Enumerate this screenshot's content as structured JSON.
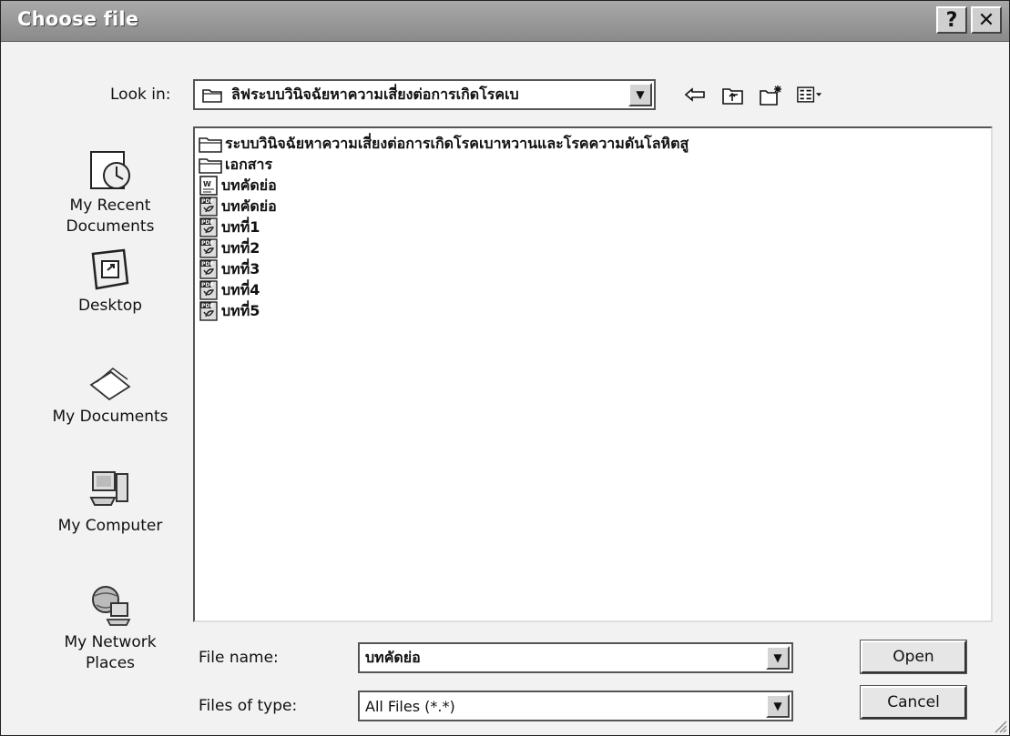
{
  "window": {
    "title": "Choose file"
  },
  "titlebar_buttons": {
    "help_label": "?",
    "close_label": "✕"
  },
  "look_in": {
    "label": "Look in:",
    "value": "ลิฟระบบวินิจฉัยหาความเสี่ยงต่อการเกิดโรคเบ"
  },
  "toolbar": {
    "icons": [
      "back-icon",
      "up-folder-icon",
      "new-folder-icon",
      "views-menu-icon"
    ]
  },
  "places": [
    {
      "name": "my-recent-documents",
      "line1": "My Recent",
      "line2": "Documents",
      "icon": "recent-documents-icon"
    },
    {
      "name": "desktop",
      "line1": "Desktop",
      "line2": "",
      "icon": "desktop-icon"
    },
    {
      "name": "my-documents",
      "line1": "My Documents",
      "line2": "",
      "icon": "my-documents-icon"
    },
    {
      "name": "my-computer",
      "line1": "My Computer",
      "line2": "",
      "icon": "computer-icon"
    },
    {
      "name": "my-network-places",
      "line1": "My Network",
      "line2": "Places",
      "icon": "network-places-icon"
    }
  ],
  "files": [
    {
      "name": "ระบบวินิจฉัยหาความเสี่ยงต่อการเกิดโรคเบาหวานและโรคความดันโลหิตสู",
      "type": "folder"
    },
    {
      "name": "เอกสาร",
      "type": "folder"
    },
    {
      "name": "บทคัดย่อ",
      "type": "word"
    },
    {
      "name": "บทคัดย่อ",
      "type": "pdf"
    },
    {
      "name": "บทที่1",
      "type": "pdf"
    },
    {
      "name": "บทที่2",
      "type": "pdf"
    },
    {
      "name": "บทที่3",
      "type": "pdf"
    },
    {
      "name": "บทที่4",
      "type": "pdf"
    },
    {
      "name": "บทที่5",
      "type": "pdf"
    }
  ],
  "file_name": {
    "label": "File name:",
    "value": "บทคัดย่อ"
  },
  "files_of_type": {
    "label": "Files of type:",
    "value": "All Files (*.*)"
  },
  "buttons": {
    "open": "Open",
    "cancel": "Cancel"
  },
  "colors": {
    "titlebar": "#8f8f8f",
    "dialog_bg": "#f2f2f2",
    "list_bg": "#ffffff"
  }
}
